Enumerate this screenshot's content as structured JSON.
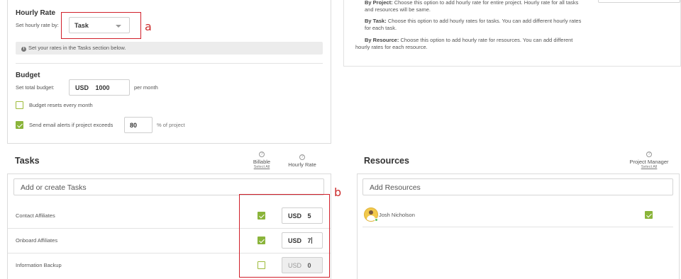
{
  "hourly_rate": {
    "title": "Hourly Rate",
    "set_label": "Set hourly rate by:",
    "selected": "Task",
    "info": "Set your rates in the Tasks section below."
  },
  "budget": {
    "title": "Budget",
    "set_label": "Set total budget:",
    "currency": "USD",
    "amount": "1000",
    "period": "per month",
    "resets_label": "Budget resets every month",
    "alerts_label": "Send email alerts if project exceeds",
    "alerts_value": "80",
    "alerts_suffix": "% of project"
  },
  "descriptions": {
    "by_project_head": "By Project:",
    "by_project_text": "Choose this option to add hourly rate for entire project. Hourly rate for all tasks",
    "by_project_text2": "and resources will be same.",
    "by_task_head": "By Task:",
    "by_task_text": "Choose this option to add hourly rates for tasks. You can add different hourly rates",
    "by_task_text2": "for each task.",
    "by_resource_head": "By Resource:",
    "by_resource_text": "Choose this option to add hourly rate for resources. You can add different",
    "by_resource_text2": "hourly rates for each resource."
  },
  "tasks": {
    "title": "Tasks",
    "billable_header": "Billable",
    "billable_select_all": "Select All",
    "rate_header": "Hourly Rate",
    "add_placeholder": "Add or create Tasks",
    "currency": "USD",
    "rows": [
      {
        "name": "Contact Affiliates",
        "billable": true,
        "rate": "5"
      },
      {
        "name": "Onboard Affiliates",
        "billable": true,
        "rate": "7"
      },
      {
        "name": "Information Backup",
        "billable": false,
        "rate": "0"
      }
    ]
  },
  "resources": {
    "title": "Resources",
    "pm_header": "Project Manager",
    "pm_select_all": "Select All",
    "add_placeholder": "Add Resources",
    "rows": [
      {
        "name": "Josh Nicholson",
        "project_manager": true
      }
    ]
  },
  "annotations": {
    "a": "a",
    "b": "b"
  },
  "colors": {
    "accent_green": "#8ab43a",
    "annotation_red": "#d11f2a"
  },
  "icons": [
    "info-icon",
    "help-icon",
    "chevron-down-icon",
    "checkbox-icon",
    "avatar-icon"
  ]
}
